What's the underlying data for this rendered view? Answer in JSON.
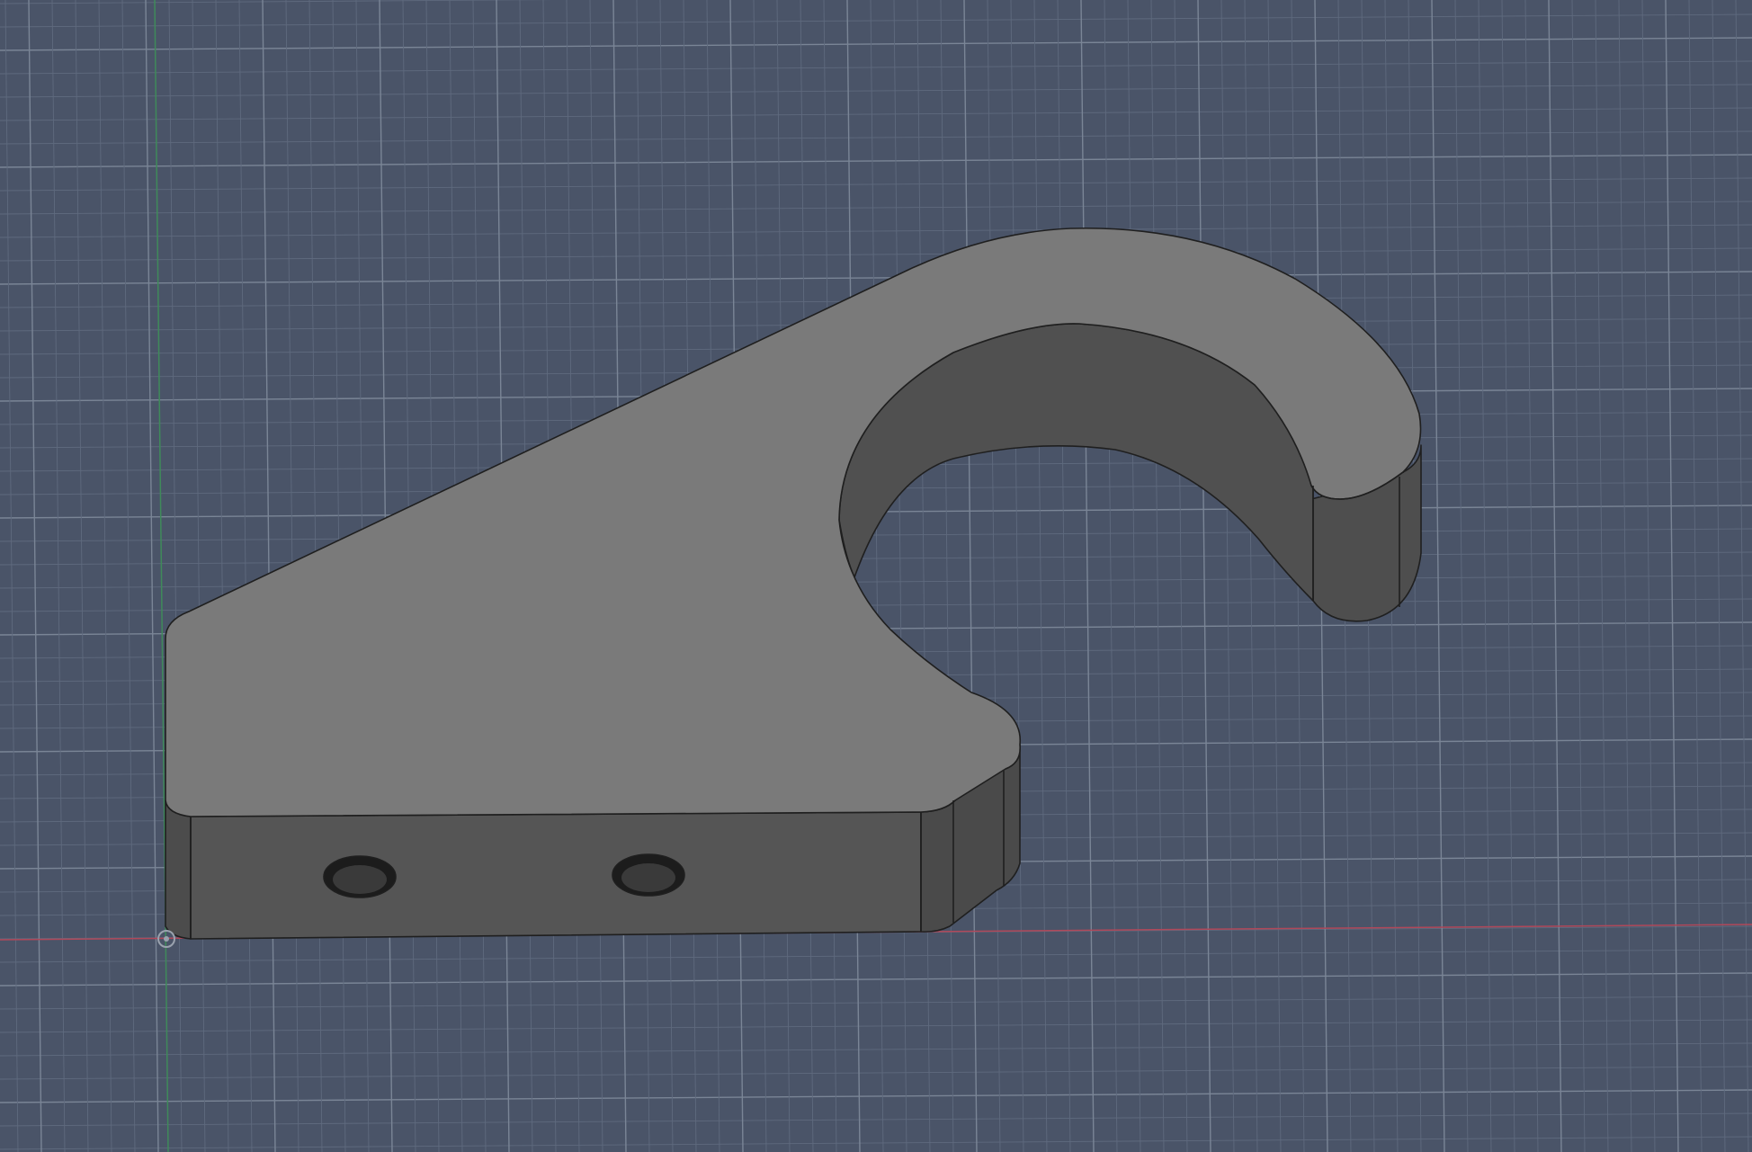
{
  "viewport": {
    "background_color": "#4a5468",
    "grid_minor_color": "#5f6a7e",
    "grid_major_color": "#7a8596",
    "x_axis_color": "#b0485a",
    "y_axis_color": "#3f8a5a"
  },
  "model": {
    "top_face_color": "#7a7a7a",
    "front_face_color": "#555555",
    "side_face_color": "#4b4b4b",
    "inner_face_color": "#505050",
    "edge_color": "#1f1f1f",
    "hole_color": "#1c1c1c"
  },
  "icons": {
    "origin": "origin-marker-icon"
  }
}
